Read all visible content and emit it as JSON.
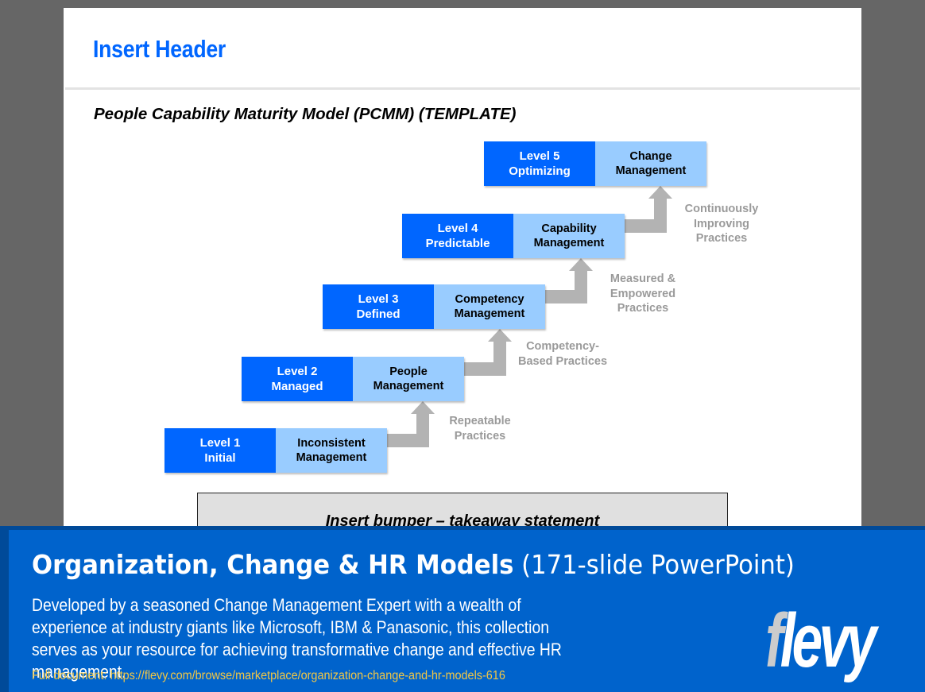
{
  "slide": {
    "header": "Insert Header",
    "subtitle": "People Capability Maturity Model (PCMM) (TEMPLATE)",
    "levels": [
      {
        "level": "Level 1",
        "name": "Initial",
        "focus_line1": "Inconsistent",
        "focus_line2": "Management"
      },
      {
        "level": "Level 2",
        "name": "Managed",
        "focus_line1": "People",
        "focus_line2": "Management"
      },
      {
        "level": "Level 3",
        "name": "Defined",
        "focus_line1": "Competency",
        "focus_line2": "Management"
      },
      {
        "level": "Level 4",
        "name": "Predictable",
        "focus_line1": "Capability",
        "focus_line2": "Management"
      },
      {
        "level": "Level 5",
        "name": "Optimizing",
        "focus_line1": "Change",
        "focus_line2": "Management"
      }
    ],
    "transitions": [
      {
        "line1": "Repeatable",
        "line2": "Practices",
        "line3": ""
      },
      {
        "line1": "Competency-",
        "line2": "Based Practices",
        "line3": ""
      },
      {
        "line1": "Measured &",
        "line2": "Empowered",
        "line3": "Practices"
      },
      {
        "line1": "Continuously",
        "line2": "Improving",
        "line3": "Practices"
      }
    ],
    "bumper": "Insert bumper – takeaway statement"
  },
  "colors": {
    "level_dark": "#0066ff",
    "level_light": "#99ccff",
    "arrow": "#b3b3b3",
    "header": "#0066ff",
    "banner": "#0063cc",
    "link": "#f2c744"
  },
  "banner": {
    "title_strong": "Organization, Change & HR Models",
    "title_light": "(171-slide PowerPoint)",
    "description": "Developed by a seasoned Change Management Expert with a wealth of experience at industry giants like Microsoft, IBM & Panasonic, this collection serves as your resource for achieving transformative change and effective HR management.",
    "link": "Full document: https://flevy.com/browse/marketplace/organization-change-and-hr-models-616",
    "logo_f": "f",
    "logo_rest": "levy"
  }
}
